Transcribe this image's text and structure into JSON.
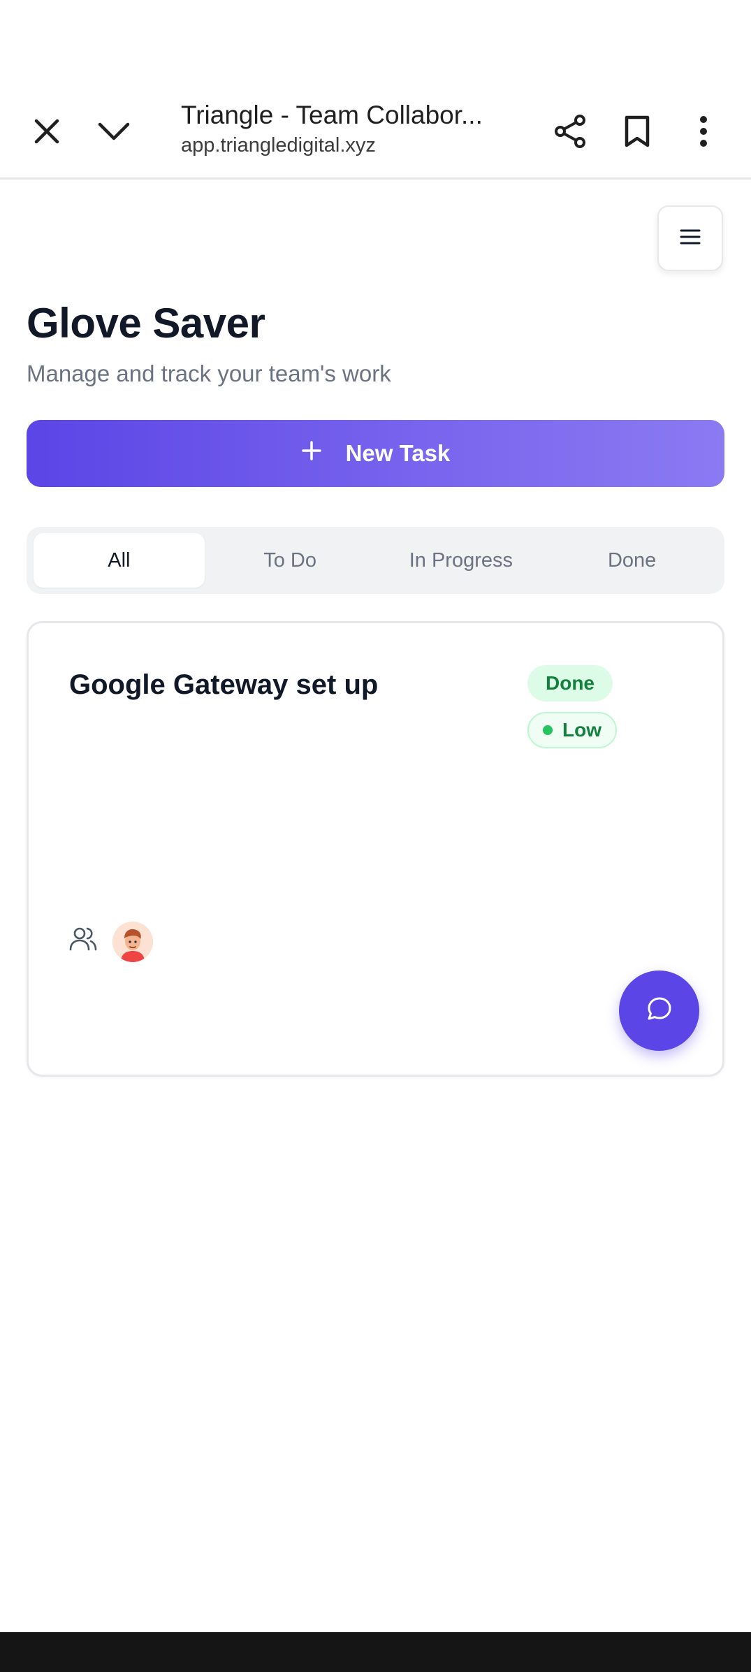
{
  "browser": {
    "title": "Triangle - Team Collabor...",
    "url": "app.triangledigital.xyz"
  },
  "page": {
    "title": "Glove Saver",
    "subtitle": "Manage and track your team's work"
  },
  "actions": {
    "new_task_label": "New Task"
  },
  "tabs": [
    {
      "label": "All",
      "active": true
    },
    {
      "label": "To Do",
      "active": false
    },
    {
      "label": "In Progress",
      "active": false
    },
    {
      "label": "Done",
      "active": false
    }
  ],
  "tasks": [
    {
      "title": "Google Gateway set up",
      "status": "Done",
      "priority": "Low",
      "status_color": "#15803d",
      "priority_dot_color": "#22c55e"
    }
  ],
  "colors": {
    "accent": "#5b45e6",
    "accent_light": "#8b7af2",
    "success": "#15803d"
  },
  "icons": {
    "close": "close-icon",
    "collapse": "chevron-down-icon",
    "share": "share-icon",
    "bookmark": "bookmark-icon",
    "more": "more-vertical-icon",
    "menu": "hamburger-icon",
    "add": "plus-icon",
    "team": "users-icon",
    "chat": "chat-icon"
  }
}
